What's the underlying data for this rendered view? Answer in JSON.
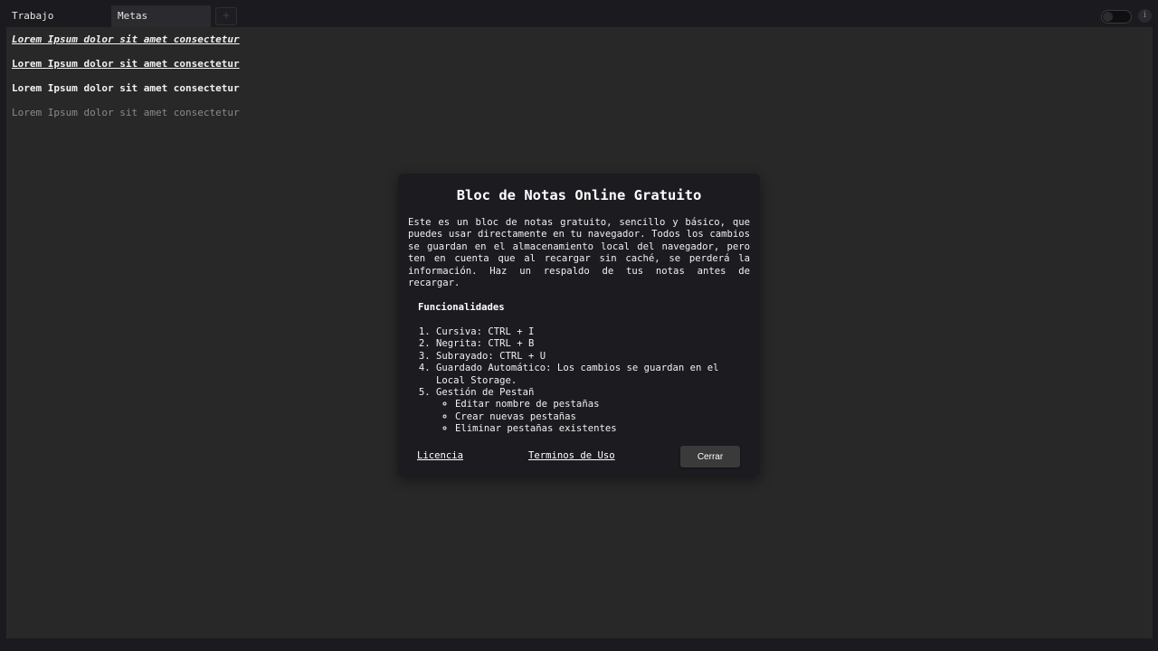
{
  "tabs": [
    {
      "label": "Trabajo",
      "active": false
    },
    {
      "label": "Metas",
      "active": true
    }
  ],
  "add_tab_label": "+",
  "info_label": "i",
  "editor": {
    "lines": [
      "Lorem Ipsum dolor sit amet consectetur",
      "Lorem Ipsum dolor sit amet consectetur",
      "Lorem Ipsum dolor sit amet consectetur",
      "Lorem Ipsum dolor sit amet consectetur"
    ]
  },
  "modal": {
    "title": "Bloc de Notas Online Gratuito",
    "description": "Este es un bloc de notas gratuito, sencillo y básico, que puedes usar directamente en tu navegador. Todos los cambios se guardan en el almacenamiento local del navegador, pero ten en cuenta que al recargar sin caché, se perderá la información. Haz un respaldo de tus notas antes de recargar.",
    "features_title": "Funcionalidades",
    "features": [
      "Cursiva: CTRL + I",
      "Negrita: CTRL + B",
      "Subrayado: CTRL + U",
      "Guardado Automático: Los cambios se guardan en el Local Storage.",
      "Gestión de Pestañ"
    ],
    "tab_features": [
      "Editar nombre de pestañas",
      "Crear nuevas pestañas",
      "Eliminar pestañas existentes"
    ],
    "license_label": "Licencia",
    "terms_label": "Terminos de Uso",
    "close_label": "Cerrar"
  },
  "colors": {
    "background": "#1b1b1f",
    "editor_bg": "#282828",
    "modal_bg": "#1c1b20",
    "button_bg": "#3a3a3a"
  }
}
